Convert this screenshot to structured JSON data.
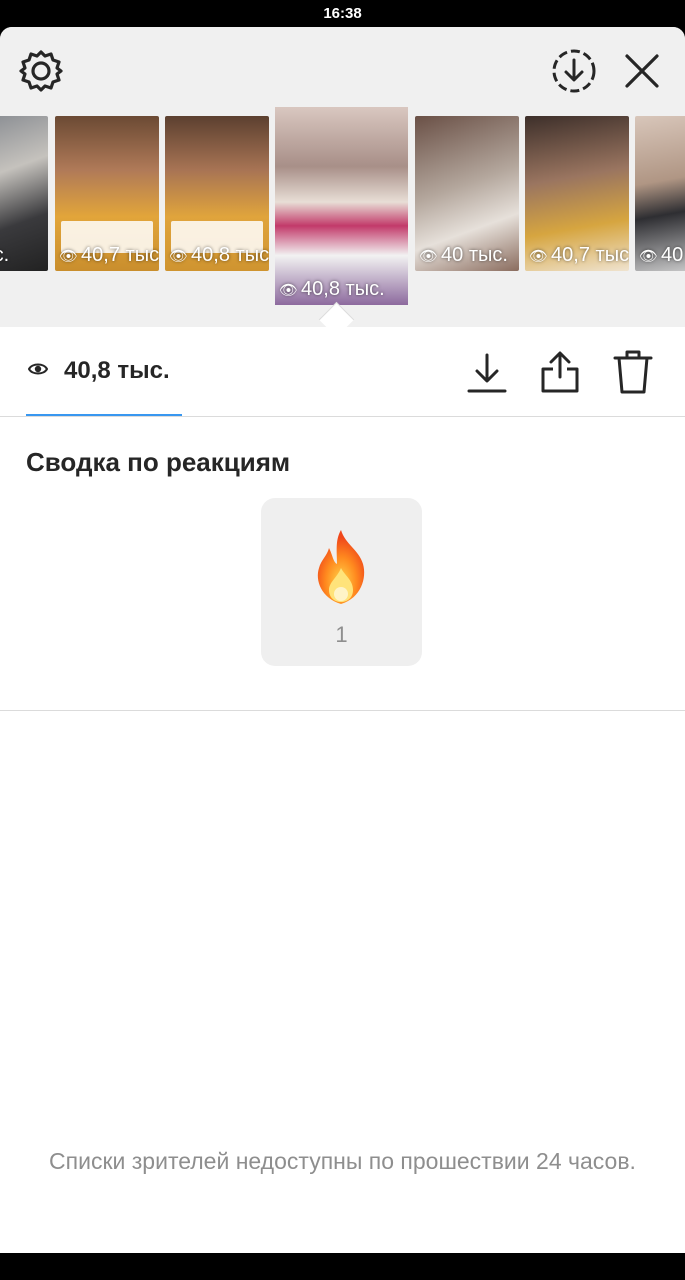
{
  "status_bar": {
    "time": "16:38"
  },
  "header": {
    "settings_icon": "gear-icon",
    "download_circle_icon": "download-circle-icon",
    "close_icon": "close-icon"
  },
  "stories": [
    {
      "views": "тыс.",
      "active": false
    },
    {
      "views": "40,7 тыс.",
      "active": false
    },
    {
      "views": "40,8 тыс.",
      "active": false
    },
    {
      "views": "40,8 тыс.",
      "active": true
    },
    {
      "views": "40 тыс.",
      "active": false
    },
    {
      "views": "40,7 тыс.",
      "active": false
    },
    {
      "views": "40",
      "active": false
    }
  ],
  "stats": {
    "views_count": "40,8 тыс.",
    "actions": [
      "download-icon",
      "share-icon",
      "trash-icon"
    ]
  },
  "reactions": {
    "title": "Сводка по реакциям",
    "items": [
      {
        "emoji": "🔥",
        "count": "1"
      }
    ]
  },
  "footer": {
    "note": "Списки зрителей недоступны по прошествии 24 часов."
  },
  "colors": {
    "accent": "#3897f0",
    "text": "#262626",
    "muted": "#8e8e8e"
  }
}
